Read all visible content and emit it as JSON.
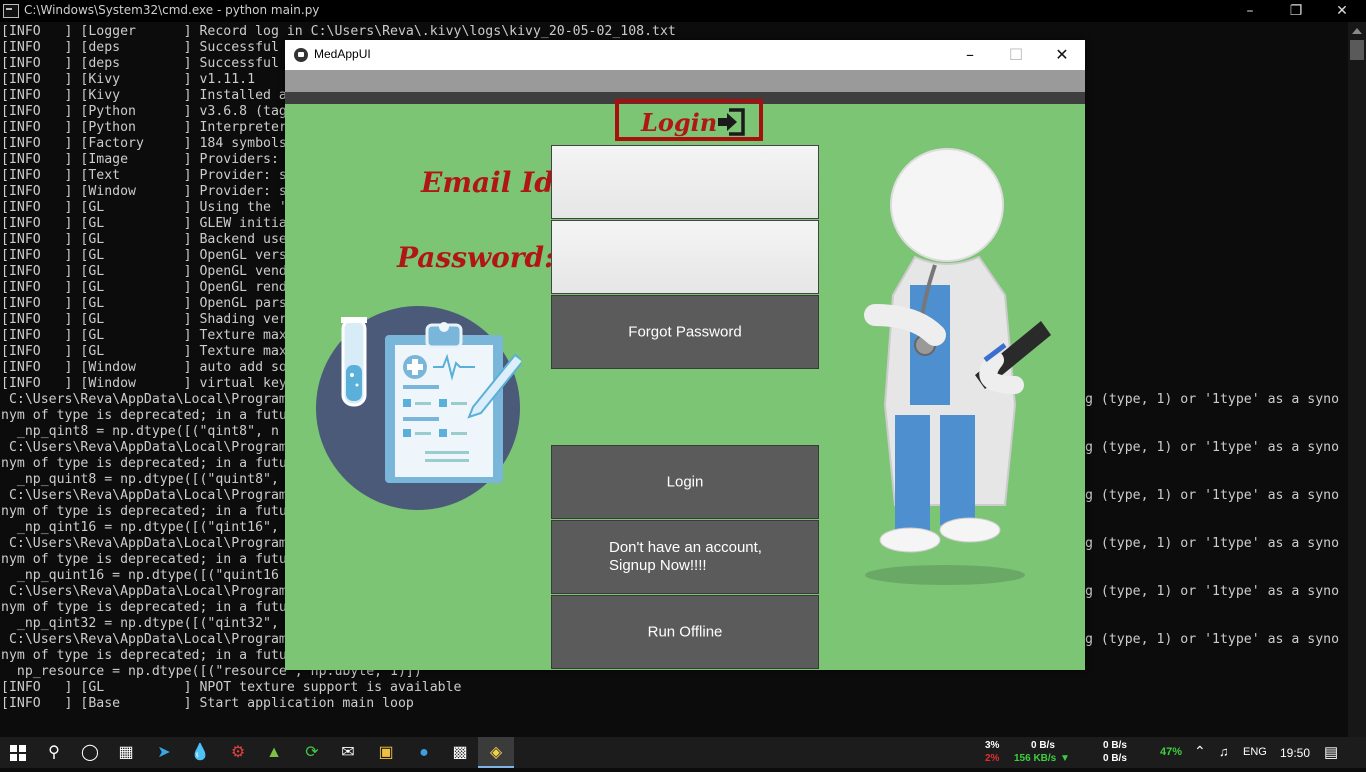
{
  "console": {
    "title": "C:\\Windows\\System32\\cmd.exe - python  main.py",
    "lines": [
      "[INFO   ] [Logger      ] Record log in C:\\Users\\Reva\\.kivy\\logs\\kivy_20-05-02_108.txt",
      "[INFO   ] [deps        ] Successful",
      "[INFO   ] [deps        ] Successful",
      "[INFO   ] [Kivy        ] v1.11.1",
      "[INFO   ] [Kivy        ] Installed a",
      "[INFO   ] [Python      ] v3.6.8 (tag",
      "[INFO   ] [Python      ] Interpreter",
      "[INFO   ] [Factory     ] 184 symbols",
      "[INFO   ] [Image       ] Providers:",
      "[INFO   ] [Text        ] Provider: s",
      "[INFO   ] [Window      ] Provider: s",
      "[INFO   ] [GL          ] Using the '",
      "[INFO   ] [GL          ] GLEW initia",
      "[INFO   ] [GL          ] Backend use",
      "[INFO   ] [GL          ] OpenGL vers",
      "[INFO   ] [GL          ] OpenGL vend",
      "[INFO   ] [GL          ] OpenGL rend",
      "[INFO   ] [GL          ] OpenGL pars",
      "[INFO   ] [GL          ] Shading ver",
      "[INFO   ] [GL          ] Texture max",
      "[INFO   ] [GL          ] Texture max",
      "[INFO   ] [Window      ] auto add so",
      "[INFO   ] [Window      ] virtual key",
      " C:\\Users\\Reva\\AppData\\Local\\Program",
      "nym of type is deprecated; in a futu",
      "  _np_qint8 = np.dtype([(\"qint8\", n",
      " C:\\Users\\Reva\\AppData\\Local\\Program",
      "nym of type is deprecated; in a futu",
      "  _np_quint8 = np.dtype([(\"quint8\",",
      " C:\\Users\\Reva\\AppData\\Local\\Program",
      "nym of type is deprecated; in a futu",
      "  _np_qint16 = np.dtype([(\"qint16\",",
      " C:\\Users\\Reva\\AppData\\Local\\Program",
      "nym of type is deprecated; in a futu",
      "  _np_quint16 = np.dtype([(\"quint16",
      " C:\\Users\\Reva\\AppData\\Local\\Program",
      "nym of type is deprecated; in a futu",
      "  _np_qint32 = np.dtype([(\"qint32\",",
      " C:\\Users\\Reva\\AppData\\Local\\Program",
      "nym of type is deprecated; in a futu",
      "  np_resource = np.dtype([(\"resource\", np.ubyte, 1)])",
      "[INFO   ] [GL          ] NPOT texture support is available",
      "[INFO   ] [Base        ] Start application main loop"
    ],
    "right_fragment": "g (type, 1) or '1type' as a syno"
  },
  "app": {
    "title": "MedAppUI",
    "login_heading": "Login",
    "email_label": "Email Id:",
    "password_label": "Password:",
    "email_value": "",
    "password_value": "",
    "forgot_password": "Forgot Password",
    "login_button": "Login",
    "signup_button": "Don't have an account,\nSignup Now!!!!",
    "offline_button": "Run Offline"
  },
  "taskbar": {
    "cpu": "3%",
    "ram": "2%",
    "net_up": "0 B/s",
    "net_down": "156 KB/s",
    "disk_read": "0 B/s",
    "disk_write": "0 B/s",
    "battery": "47%",
    "language": "ENG",
    "time": "19:50"
  },
  "colors": {
    "app_bg": "#7bc574",
    "heading_red": "#b01818",
    "button_gray": "#5b5b5b"
  }
}
